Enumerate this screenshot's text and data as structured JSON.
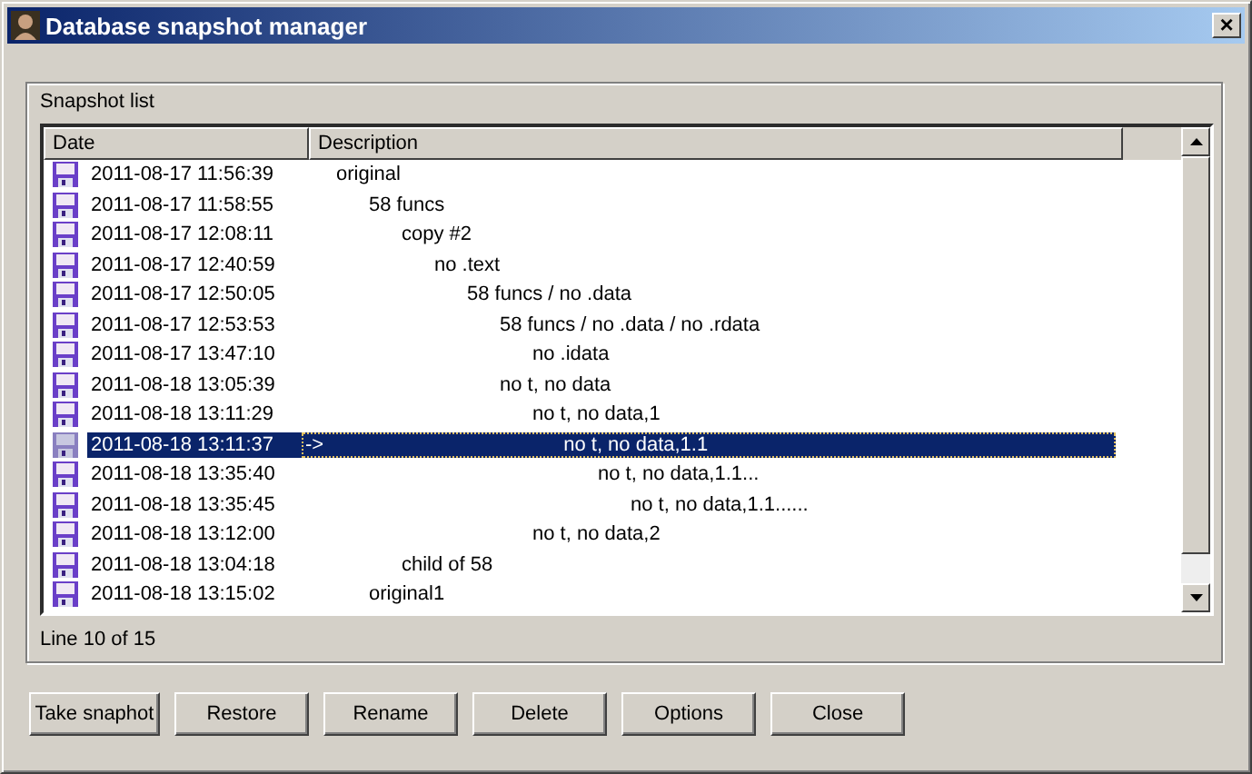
{
  "window": {
    "title": "Database snapshot manager",
    "close": "×"
  },
  "group": {
    "label": "Snapshot list"
  },
  "table": {
    "columns": [
      "Date",
      "Description"
    ],
    "tree": [
      {
        "date": "2011-08-17 11:56:39",
        "description": "original",
        "selected": false,
        "children": [
          {
            "date": "2011-08-17 11:58:55",
            "description": "58 funcs",
            "selected": false,
            "children": [
              {
                "date": "2011-08-17 12:08:11",
                "description": "copy #2",
                "selected": false,
                "children": [
                  {
                    "date": "2011-08-17 12:40:59",
                    "description": "no .text",
                    "selected": false,
                    "children": [
                      {
                        "date": "2011-08-17 12:50:05",
                        "description": "58 funcs / no .data",
                        "selected": false,
                        "children": [
                          {
                            "date": "2011-08-17 12:53:53",
                            "description": "58 funcs / no .data / no .rdata",
                            "selected": false,
                            "children": [
                              {
                                "date": "2011-08-17 13:47:10",
                                "description": "no .idata",
                                "selected": false
                              }
                            ]
                          },
                          {
                            "date": "2011-08-18 13:05:39",
                            "description": "no t, no data",
                            "selected": false,
                            "children": [
                              {
                                "date": "2011-08-18 13:11:29",
                                "description": "no t, no data,1",
                                "selected": false,
                                "children": [
                                  {
                                    "date": "2011-08-18 13:11:37",
                                    "description": "no t, no data,1.1",
                                    "selected": true,
                                    "pointer": "->",
                                    "children": [
                                      {
                                        "date": "2011-08-18 13:35:40",
                                        "description": "no t, no data,1.1...",
                                        "selected": false,
                                        "children": [
                                          {
                                            "date": "2011-08-18 13:35:45",
                                            "description": "no t, no data,1.1......",
                                            "selected": false
                                          }
                                        ]
                                      }
                                    ]
                                  }
                                ]
                              },
                              {
                                "date": "2011-08-18 13:12:00",
                                "description": "no t, no data,2",
                                "selected": false
                              }
                            ]
                          }
                        ]
                      }
                    ]
                  }
                ]
              },
              {
                "date": "2011-08-18 13:04:18",
                "description": "child of 58",
                "selected": false
              }
            ]
          },
          {
            "date": "2011-08-18 13:15:02",
            "description": "original1",
            "selected": false
          }
        ]
      }
    ]
  },
  "status": "Line 10 of 15",
  "buttons": [
    "Take snaphot",
    "Restore",
    "Rename",
    "Delete",
    "Options",
    "Close"
  ]
}
